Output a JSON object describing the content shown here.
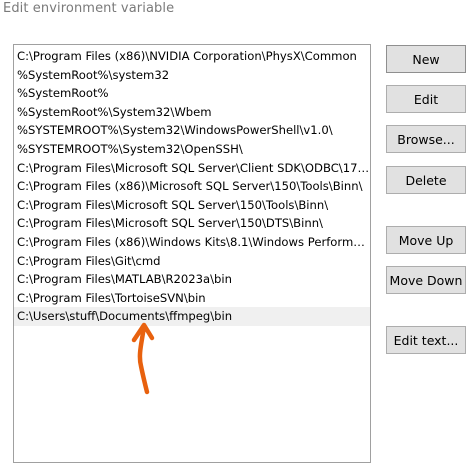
{
  "window": {
    "title": "Edit environment variable"
  },
  "paths": [
    "C:\\Program Files (x86)\\NVIDIA Corporation\\PhysX\\Common",
    "%SystemRoot%\\system32",
    "%SystemRoot%",
    "%SystemRoot%\\System32\\Wbem",
    "%SYSTEMROOT%\\System32\\WindowsPowerShell\\v1.0\\",
    "%SYSTEMROOT%\\System32\\OpenSSH\\",
    "C:\\Program Files\\Microsoft SQL Server\\Client SDK\\ODBC\\170\\Tools...",
    "C:\\Program Files (x86)\\Microsoft SQL Server\\150\\Tools\\Binn\\",
    "C:\\Program Files\\Microsoft SQL Server\\150\\Tools\\Binn\\",
    "C:\\Program Files\\Microsoft SQL Server\\150\\DTS\\Binn\\",
    "C:\\Program Files (x86)\\Windows Kits\\8.1\\Windows Performance To...",
    "C:\\Program Files\\Git\\cmd",
    "C:\\Program Files\\MATLAB\\R2023a\\bin",
    "C:\\Program Files\\TortoiseSVN\\bin",
    "C:\\Users\\stuff\\Documents\\ffmpeg\\bin"
  ],
  "selected_index": 14,
  "buttons": {
    "new": "New",
    "edit": "Edit",
    "browse": "Browse...",
    "delete": "Delete",
    "move_up": "Move Up",
    "move_down": "Move Down",
    "edit_text": "Edit text..."
  },
  "annotation": {
    "arrow_color": "#e8610e"
  }
}
